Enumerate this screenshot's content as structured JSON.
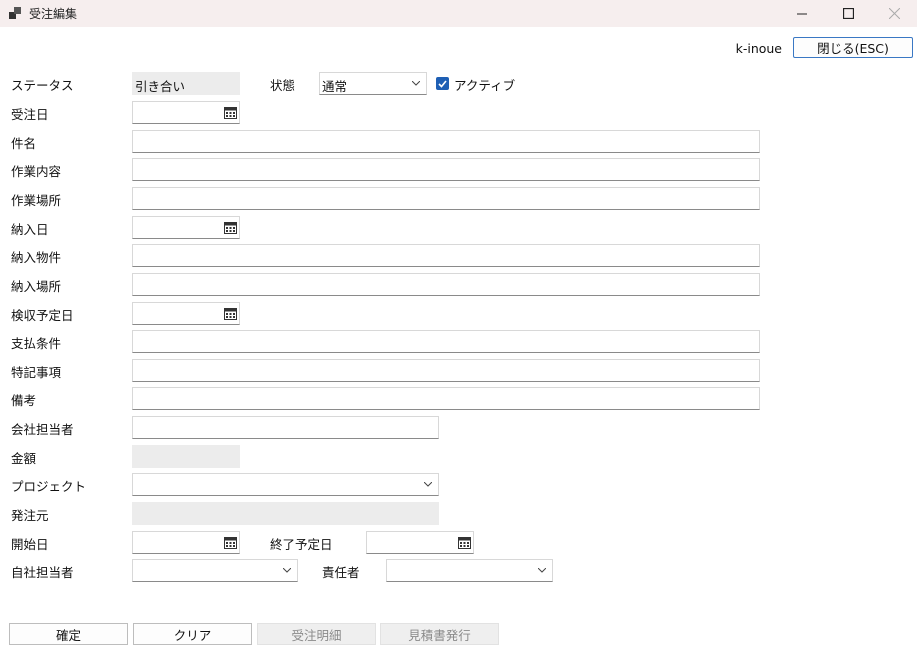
{
  "window": {
    "title": "受注編集",
    "icons": {
      "app": "app-icon",
      "minimize": "minimize-icon",
      "maximize": "maximize-icon",
      "close": "close-icon"
    }
  },
  "header": {
    "user": "k-inoue",
    "close_button": "閉じる(ESC)"
  },
  "status": {
    "label": "ステータス",
    "value": "引き合い"
  },
  "state": {
    "label": "状態",
    "selected": "通常"
  },
  "active": {
    "label": "アクティブ",
    "checked": true
  },
  "labels": {
    "order_date": "受注日",
    "subject": "件名",
    "work_content": "作業内容",
    "work_place": "作業場所",
    "delivery_date": "納入日",
    "delivery_item": "納入物件",
    "delivery_place": "納入場所",
    "inspection_date": "検収予定日",
    "payment_terms": "支払条件",
    "special_notes": "特記事項",
    "remarks": "備考",
    "client_contact": "会社担当者",
    "amount": "金額",
    "project": "プロジェクト",
    "orderer": "発注元",
    "start_date": "開始日",
    "end_date": "終了予定日",
    "own_contact": "自社担当者",
    "manager": "責任者"
  },
  "buttons": {
    "confirm": "確定",
    "clear": "クリア",
    "order_detail": "受注明細",
    "estimate": "見積書発行"
  },
  "colors": {
    "titlebar": "#f6eeee",
    "accent": "#1e5fb4"
  }
}
